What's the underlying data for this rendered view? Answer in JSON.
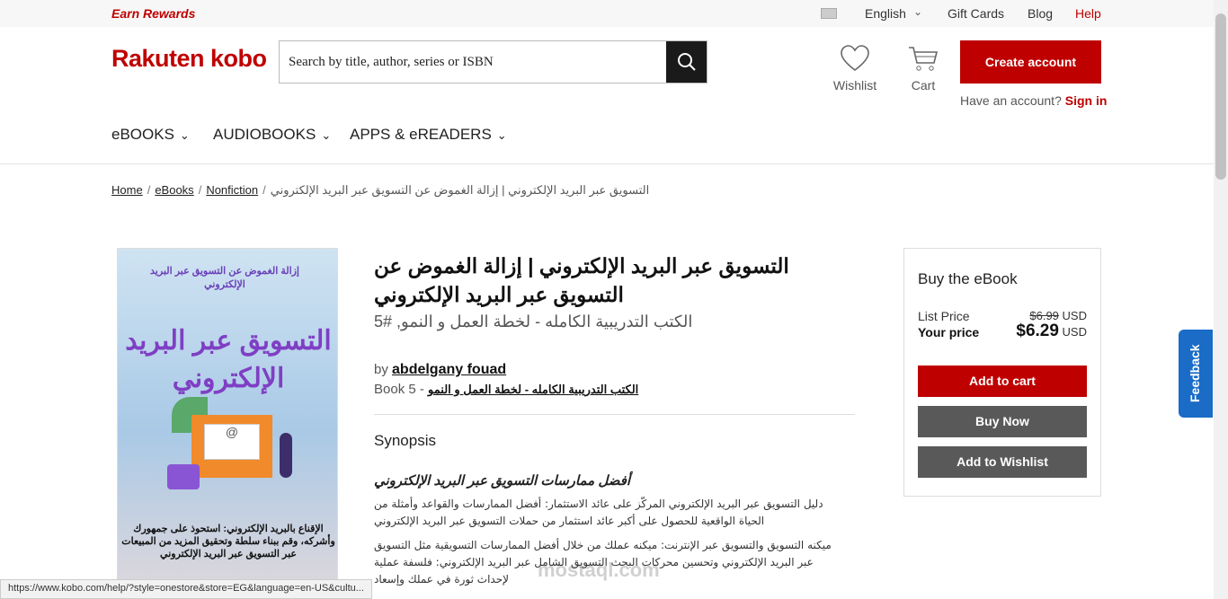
{
  "topbar": {
    "rewards": "Earn Rewards",
    "language": "English",
    "gift_cards": "Gift Cards",
    "blog": "Blog",
    "help": "Help"
  },
  "header": {
    "logo": "Rakuten kobo",
    "search_placeholder": "Search by title, author, series or ISBN",
    "wishlist": "Wishlist",
    "cart": "Cart",
    "create_account": "Create account",
    "have_account": "Have an account?",
    "sign_in": "Sign in"
  },
  "nav": {
    "items": [
      {
        "label": "eBOOKS"
      },
      {
        "label": "AUDIOBOOKS"
      },
      {
        "label": "APPS & eREADERS"
      }
    ]
  },
  "breadcrumb": {
    "home": "Home",
    "ebooks": "eBooks",
    "nonfiction": "Nonfiction",
    "current": "التسويق عبر البريد الإلكتروني | إزالة الغموض عن التسويق عبر البريد الإلكتروني"
  },
  "cover": {
    "top_text": "إزالة الغموض عن التسويق عبر البريد الإلكتروني",
    "main_text": "التسويق عبر البريد الإلكتروني",
    "bottom_text": "الإقناع بالبريد الإلكتروني: استحوذ على جمهورك وأشركه، وقم ببناء سلطة وتحقيق المزيد من المبيعات عبر التسويق عبر البريد الإلكتروني"
  },
  "book": {
    "title": "التسويق عبر البريد الإلكتروني | إزالة الغموض عن التسويق عبر البريد الإلكتروني",
    "series_line": "الكتب التدريبية الكامله - لخطة العمل و النمو, #5",
    "by": "by",
    "author": "abdelgany fouad",
    "book_no": "Book 5 -",
    "series_link": "الكتب التدريبية الكامله - لخطة العمل و النمو"
  },
  "synopsis": {
    "heading": "Synopsis",
    "subheading": "أفضل ممارسات التسويق عبر البريد الإلكتروني",
    "para1": "دليل التسويق عبر البريد الإلكتروني المركّز على عائد الاستثمار: أفضل الممارسات والقواعد وأمثلة من الحياة الواقعية للحصول على أكبر عائد استثمار من حملات التسويق عبر البريد الإلكتروني",
    "para2": "ميكنه التسويق والتسويق عبر الإنترنت: ميكنه عملك من خلال أفضل الممارسات التسويقية مثل التسويق عبر البريد الإلكتروني وتحسين محركات البحث التسويق الشامل عبر البريد الإلكتروني: فلسفة عملية لإحداث ثورة في عملك وإسعاد"
  },
  "buybox": {
    "heading": "Buy the eBook",
    "list_price_label": "List Price",
    "list_price": "$6.99",
    "currency": "USD",
    "your_price_label": "Your price",
    "your_price": "$6.29",
    "add_to_cart": "Add to cart",
    "buy_now": "Buy Now",
    "add_to_wishlist": "Add to Wishlist"
  },
  "feedback": "Feedback",
  "statusbar": "https://www.kobo.com/help/?style=onestore&store=EG&language=en-US&cultu...",
  "watermark": "mostaql.com"
}
